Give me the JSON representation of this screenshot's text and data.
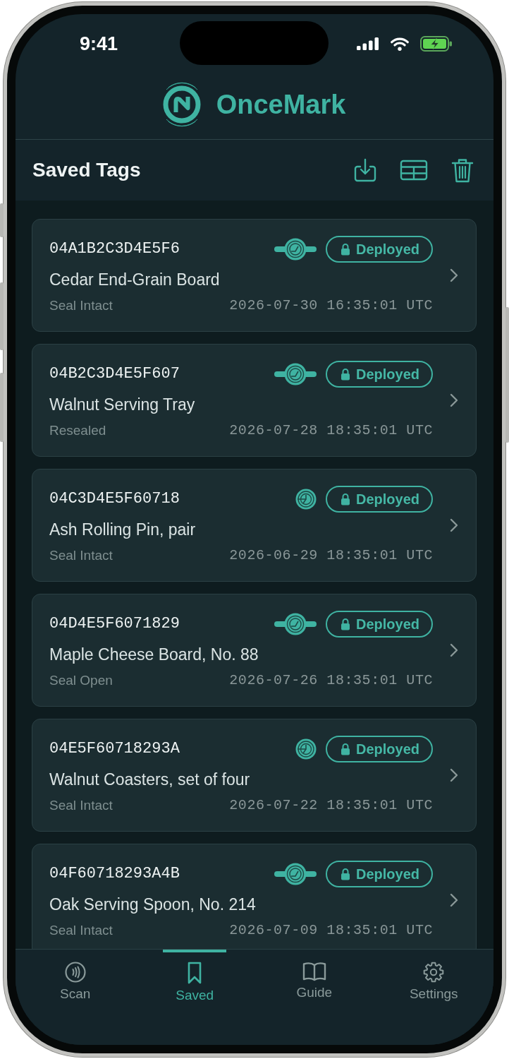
{
  "status_bar": {
    "time": "9:41"
  },
  "app_header": {
    "title": "OnceMark"
  },
  "toolbar": {
    "title": "Saved Tags"
  },
  "tags": [
    {
      "uid": "04A1B2C3D4E5F6",
      "kind": "strap",
      "status": "Deployed",
      "name": "Cedar End-Grain Board",
      "seal": "Seal Intact",
      "timestamp": "2026-07-30 16:35:01 UTC"
    },
    {
      "uid": "04B2C3D4E5F607",
      "kind": "strap",
      "status": "Deployed",
      "name": "Walnut Serving Tray",
      "seal": "Resealed",
      "timestamp": "2026-07-28 18:35:01 UTC"
    },
    {
      "uid": "04C3D4E5F60718",
      "kind": "coin",
      "status": "Deployed",
      "name": "Ash Rolling Pin, pair",
      "seal": "Seal Intact",
      "timestamp": "2026-06-29 18:35:01 UTC"
    },
    {
      "uid": "04D4E5F6071829",
      "kind": "strap",
      "status": "Deployed",
      "name": "Maple Cheese Board, No. 88",
      "seal": "Seal Open",
      "timestamp": "2026-07-26 18:35:01 UTC"
    },
    {
      "uid": "04E5F60718293A",
      "kind": "coin",
      "status": "Deployed",
      "name": "Walnut Coasters, set of four",
      "seal": "Seal Intact",
      "timestamp": "2026-07-22 18:35:01 UTC"
    },
    {
      "uid": "04F60718293A4B",
      "kind": "strap",
      "status": "Deployed",
      "name": "Oak Serving Spoon, No. 214",
      "seal": "Seal Intact",
      "timestamp": "2026-07-09 18:35:01 UTC"
    }
  ],
  "tab_bar": {
    "tabs": [
      {
        "label": "Scan",
        "selected": false
      },
      {
        "label": "Saved",
        "selected": true
      },
      {
        "label": "Guide",
        "selected": false
      },
      {
        "label": "Settings",
        "selected": false
      }
    ]
  }
}
